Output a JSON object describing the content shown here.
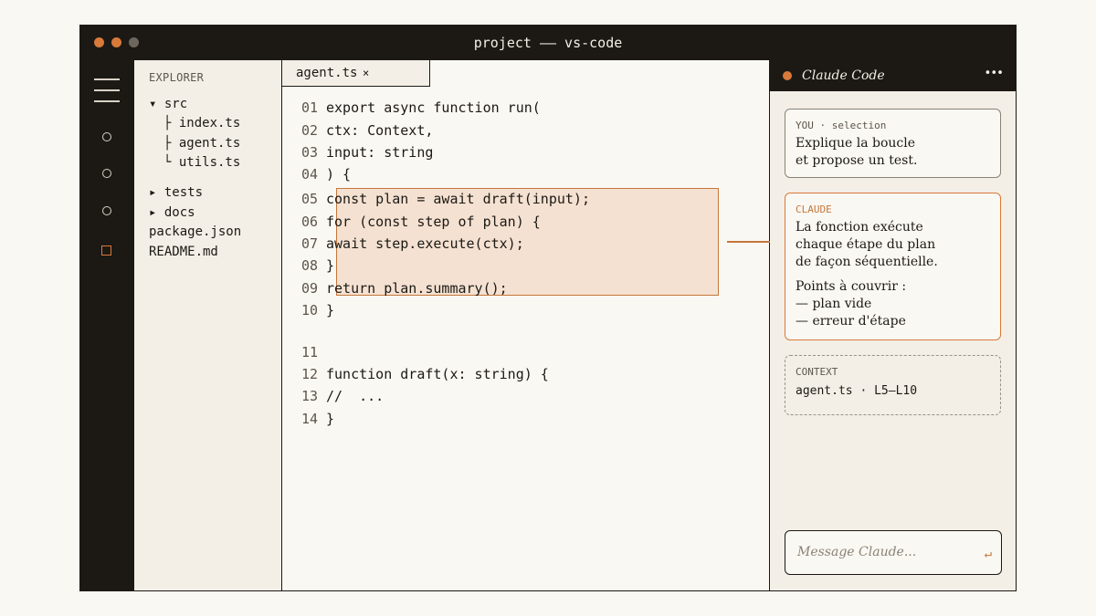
{
  "window": {
    "title": "project —— vs-code"
  },
  "explorer": {
    "title": "EXPLORER",
    "items": [
      {
        "label": "▾ src"
      },
      {
        "label": "├ index.ts"
      },
      {
        "label": "├ agent.ts"
      },
      {
        "label": "└ utils.ts"
      },
      {
        "label": "▸ tests"
      },
      {
        "label": "▸ docs"
      },
      {
        "label": "package.json"
      },
      {
        "label": "README.md"
      }
    ]
  },
  "editor": {
    "tab": {
      "label": "agent.ts",
      "close": "×"
    },
    "lines": [
      {
        "num": "01",
        "code": "export async function run("
      },
      {
        "num": "02",
        "code": "ctx: Context,"
      },
      {
        "num": "03",
        "code": "input: string"
      },
      {
        "num": "04",
        "code": ") {"
      },
      {
        "num": "05",
        "code": "const plan = await draft(input);"
      },
      {
        "num": "06",
        "code": "for (const step of plan) {"
      },
      {
        "num": "07",
        "code": "await step.execute(ctx);"
      },
      {
        "num": "08",
        "code": "}"
      },
      {
        "num": "09",
        "code": "return plan.summary();"
      },
      {
        "num": "10",
        "code": "}"
      },
      {
        "num": "11",
        "code": ""
      },
      {
        "num": "12",
        "code": "function draft(x: string) {"
      },
      {
        "num": "13",
        "code": "//  ..."
      },
      {
        "num": "14",
        "code": "}"
      }
    ]
  },
  "panel": {
    "title": "Claude Code",
    "more": "•••",
    "you": {
      "label": "YOU · selection",
      "lines": [
        "Explique la boucle",
        "et propose un test."
      ]
    },
    "claude": {
      "label": "CLAUDE",
      "lines": [
        "La fonction exécute",
        "chaque étape du plan",
        "de façon séquentielle."
      ],
      "points_title": "Points à couvrir :",
      "points": [
        "— plan vide",
        "— erreur d'étape"
      ]
    },
    "context": {
      "label": "CONTEXT",
      "value": "agent.ts · L5–L10"
    },
    "input": {
      "placeholder": "Message Claude..."
    },
    "send_icon": "↵"
  },
  "colors": {
    "accent": "#d97a3a",
    "dark": "#1c1915",
    "panel_bg": "#f3efe6",
    "page_bg": "#faf8f3"
  }
}
